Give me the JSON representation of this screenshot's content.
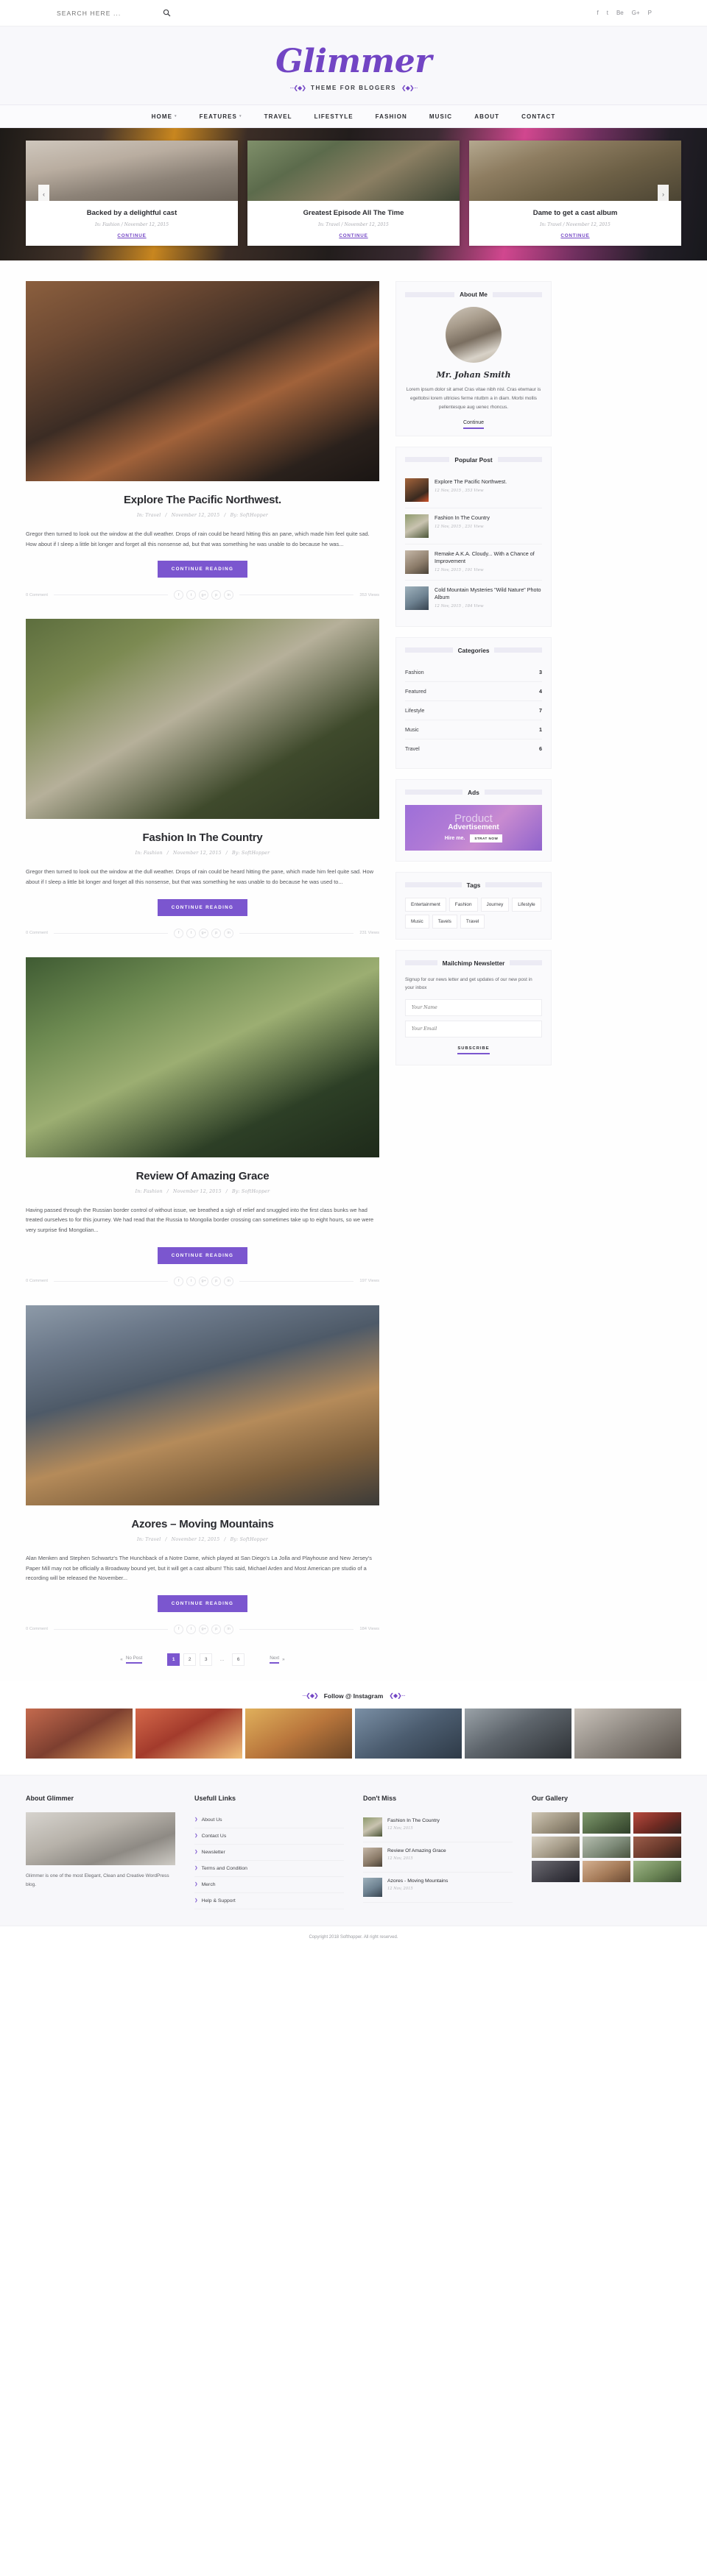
{
  "topbar": {
    "search_placeholder": "SEARCH HERE ...",
    "search_value": "",
    "search_icon": "search-icon",
    "socials": [
      "facebook",
      "twitter",
      "behance",
      "google-plus",
      "pinterest"
    ],
    "social_glyphs": [
      "f",
      "t",
      "Be",
      "G+",
      "P"
    ]
  },
  "brand": {
    "name": "Glimmer",
    "tagline": "THEME FOR BLOGERS",
    "ornament_left": "···❮◆❯",
    "ornament_right": "❮◆❯···"
  },
  "nav": {
    "items": [
      {
        "label": "HOME",
        "has_caret": true
      },
      {
        "label": "FEATURES",
        "has_caret": true
      },
      {
        "label": "TRAVEL",
        "has_caret": false
      },
      {
        "label": "LIFESTYLE",
        "has_caret": false
      },
      {
        "label": "FASHION",
        "has_caret": false
      },
      {
        "label": "MUSIC",
        "has_caret": false
      },
      {
        "label": "ABOUT",
        "has_caret": false
      },
      {
        "label": "CONTACT",
        "has_caret": false
      }
    ]
  },
  "slider": {
    "prev": "‹",
    "next": "›",
    "slides": [
      {
        "title": "Backed by a delightful cast",
        "category": "In: Fashion",
        "date": "November 12, 2015",
        "cta": "CONTINUE"
      },
      {
        "title": "Greatest Episode All The Time",
        "category": "In: Travel",
        "date": "November 12, 2015",
        "cta": "CONTINUE"
      },
      {
        "title": "Dame to get a cast album",
        "category": "In: Travel",
        "date": "November 12, 2015",
        "cta": "CONTINUE"
      }
    ]
  },
  "posts": [
    {
      "title": "Explore The Pacific Northwest.",
      "category": "In: Travel",
      "date": "November 12, 2015",
      "author": "By: SoftHopper",
      "excerpt": "Gregor then turned to look out the window at the dull weather. Drops of rain could be heard hitting this an pane, which made him feel quite sad. How about if I sleep a little bit longer and forget all this nonsense ad, but that was something he was unable to do because he was...",
      "cta": "CONTINUE READING",
      "comments": "0 Comment",
      "views": "353 Views"
    },
    {
      "title": "Fashion In The Country",
      "category": "In: Fashion",
      "date": "November 12, 2015",
      "author": "By: SoftHopper",
      "excerpt": "Gregor then turned to look out the window at the dull weather. Drops of rain could be heard hitting the pane, which made him feel quite sad. How about if I sleep a little bit longer and forget all this nonsense, but that was something he was unable to do because he was used to...",
      "cta": "CONTINUE READING",
      "comments": "0 Comment",
      "views": "231 Views"
    },
    {
      "title": "Review Of Amazing Grace",
      "category": "In: Fashion",
      "date": "November 12, 2015",
      "author": "By: SoftHopper",
      "excerpt": "Having passed through the Russian border control of without issue, we breathed a sigh of relief and snuggled into the first class bunks we had treated ourselves to for this journey. We had read that the Russia to Mongolia border crossing can sometimes take up to eight hours, so we were very surprise find Mongolian...",
      "cta": "CONTINUE READING",
      "comments": "0 Comment",
      "views": "197 Views"
    },
    {
      "title": "Azores – Moving Mountains",
      "category": "In: Travel",
      "date": "November 12, 2015",
      "author": "By: SoftHopper",
      "excerpt": "Alan Menken and Stephen Schwartz's The Hunchback of a Notre Dame, which played at San Diego's La Jolla and Playhouse and New Jersey's Paper Mill may not be officially a Broadway bound yet, but it will get a cast album! This said, Michael Arden and Most American pre studio of a recording will be released  the  November...",
      "cta": "CONTINUE READING",
      "comments": "0 Comment",
      "views": "184 Views"
    }
  ],
  "post_socials": [
    "facebook",
    "twitter",
    "google-plus",
    "pinterest",
    "linkedin"
  ],
  "post_social_glyphs": [
    "f",
    "t",
    "g+",
    "p",
    "in"
  ],
  "pagination": {
    "prev_label": "No Post",
    "prev_arrow": "«",
    "next_label": "Next",
    "next_arrow": "»",
    "pages": [
      "1",
      "2",
      "3",
      "...",
      "6"
    ],
    "active": "1"
  },
  "sidebar": {
    "about": {
      "title": "About Me",
      "name": "Mr. Johan Smith",
      "text": "Lorem ipsum dolor sit amet Cras vitae nibh nisl. Cras etwmaur is egettobsi lorem ultricies ferme ntutbm a in diam. Morbi mollis pellentesque aug uenec rhoncus.",
      "cta": "Continue"
    },
    "popular": {
      "title": "Popular Post",
      "items": [
        {
          "title": "Explore The Pacific Northwest.",
          "meta": "12 Nov, 2015 ,  353 View"
        },
        {
          "title": "Fashion In The Country",
          "meta": "12 Nov, 2015 ,  231 View"
        },
        {
          "title": "Remake A.K.A. Cloudy... With a Chance of Improvement",
          "meta": "12 Nov, 2015 ,  191 View"
        },
        {
          "title": "Cold Mountain Mysteries \"Wild Nature\" Photo Album",
          "meta": "12 Nov, 2015 ,  184 View"
        }
      ]
    },
    "categories": {
      "title": "Categories",
      "items": [
        {
          "label": "Fashion",
          "count": "3"
        },
        {
          "label": "Featured",
          "count": "4"
        },
        {
          "label": "Lifestyle",
          "count": "7"
        },
        {
          "label": "Music",
          "count": "1"
        },
        {
          "label": "Travel",
          "count": "6"
        }
      ]
    },
    "ads": {
      "title": "Ads",
      "line1": "Product",
      "line2": "Advertisement",
      "hire": "Hire me.",
      "button": "STRAT NOW"
    },
    "tags": {
      "title": "Tags",
      "items": [
        "Entertainment",
        "Fashion",
        "Journey",
        "Lifestyle",
        "Music",
        "Tavels",
        "Travel"
      ]
    },
    "newsletter": {
      "title": "Mailchimp Newsletter",
      "text": "Signup for our news letter and get updates of our new post in your inbox",
      "name_placeholder": "Your Name",
      "email_placeholder": "Your Email",
      "name_value": "",
      "email_value": "",
      "button": "SUBSCRIBE"
    }
  },
  "instagram": {
    "title": "Follow @ Instagram",
    "ornament_left": "···❮◆❯",
    "ornament_right": "❮◆❯···",
    "cells": [
      "photo-1",
      "photo-2",
      "photo-3",
      "photo-4",
      "photo-5",
      "photo-6"
    ]
  },
  "footer": {
    "about": {
      "title": "About Glimmer",
      "text": "Glimmer is one of the most Elegant, Clean and Creative WordPress blog."
    },
    "links": {
      "title": "Usefull Links",
      "items": [
        "About Us",
        "Contact Us",
        "Newsletter",
        "Terms and Condition",
        "Merch",
        "Help & Support"
      ]
    },
    "dontmiss": {
      "title": "Don't Miss",
      "items": [
        {
          "title": "Fashion In The Country",
          "date": "12 Nov, 2015"
        },
        {
          "title": "Review Of Amazing Grace",
          "date": "12 Nov, 2015"
        },
        {
          "title": "Azores - Moving Mountains",
          "date": "12 Nov, 2015"
        }
      ]
    },
    "gallery": {
      "title": "Our Gallery",
      "cells": [
        "g1",
        "g2",
        "g3",
        "g4",
        "g5",
        "g6",
        "g7",
        "g8",
        "g9"
      ]
    },
    "copyright": "Copyright 2018 Softhopper. All right reserved."
  },
  "colors": {
    "accent": "#7b56cf",
    "logo": "#7245c4",
    "text": "#2c2d32",
    "muted": "#b4b5ba"
  }
}
